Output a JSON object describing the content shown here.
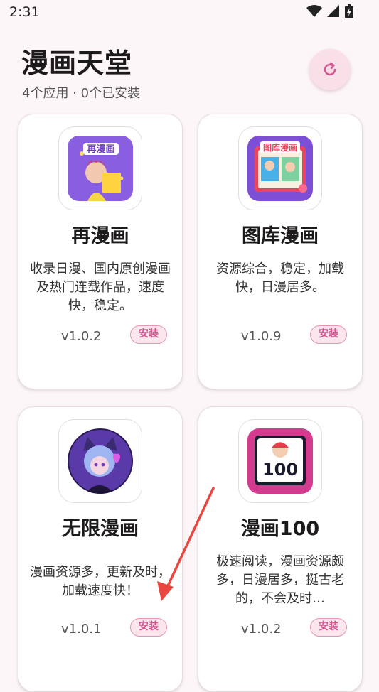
{
  "status_bar": {
    "time": "2:31"
  },
  "header": {
    "title": "漫画天堂",
    "subtitle": "4个应用 · 0个已安装"
  },
  "apps": [
    {
      "name": "再漫画",
      "description": "收录日漫、国内原创漫画及热门连载作品，速度快，稳定。",
      "version": "v1.0.2",
      "install_label": "安装",
      "icon_text": "再漫画"
    },
    {
      "name": "图库漫画",
      "description": "资源综合，稳定，加载快，日漫居多。",
      "version": "v1.0.9",
      "install_label": "安装",
      "icon_text": "图库漫画"
    },
    {
      "name": "无限漫画",
      "description": "漫画资源多，更新及时，加载速度快！",
      "version": "v1.0.1",
      "install_label": "安装"
    },
    {
      "name": "漫画100",
      "description": "极速阅读，漫画资源颇多，日漫居多，挺古老的，不会及时…",
      "version": "v1.0.2",
      "install_label": "安装",
      "icon_text": "100"
    }
  ],
  "colors": {
    "accent": "#d0578f",
    "background": "#fcf6f9",
    "arrow": "#e8463f"
  }
}
